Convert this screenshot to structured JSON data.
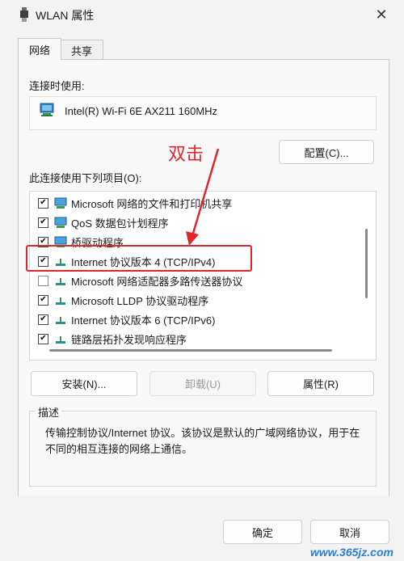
{
  "window": {
    "title": "WLAN 属性"
  },
  "tabs": [
    {
      "label": "网络"
    },
    {
      "label": "共享"
    }
  ],
  "connect_using": {
    "label": "连接时使用:",
    "adapter_name": "Intel(R) Wi-Fi 6E AX211 160MHz",
    "configure_button": "配置(C)..."
  },
  "items_section": {
    "label": "此连接使用下列项目(O):",
    "items": [
      {
        "label": "Microsoft 网络的文件和打印机共享",
        "checked": true,
        "icon": "network-share-icon"
      },
      {
        "label": "QoS 数据包计划程序",
        "checked": true,
        "icon": "network-service-icon"
      },
      {
        "label": "桥驱动程序",
        "checked": true,
        "icon": "network-service-icon"
      },
      {
        "label": "Internet 协议版本 4 (TCP/IPv4)",
        "checked": true,
        "icon": "protocol-icon"
      },
      {
        "label": "Microsoft 网络适配器多路传送器协议",
        "checked": false,
        "icon": "protocol-icon"
      },
      {
        "label": "Microsoft LLDP 协议驱动程序",
        "checked": true,
        "icon": "protocol-icon"
      },
      {
        "label": "Internet 协议版本 6 (TCP/IPv6)",
        "checked": true,
        "icon": "protocol-icon"
      },
      {
        "label": "链路层拓扑发现响应程序",
        "checked": true,
        "icon": "protocol-icon"
      }
    ]
  },
  "buttons": {
    "install": "安装(N)...",
    "uninstall": "卸载(U)",
    "properties": "属性(R)",
    "ok": "确定",
    "cancel": "取消"
  },
  "description": {
    "title": "描述",
    "text": "传输控制协议/Internet 协议。该协议是默认的广域网络协议，用于在不同的相互连接的网络上通信。"
  },
  "annotation": {
    "text": "双击"
  },
  "watermark": {
    "text": "www.365jz.com"
  },
  "colors": {
    "annotation": "#e0262d",
    "watermark": "#2a7fd1"
  }
}
